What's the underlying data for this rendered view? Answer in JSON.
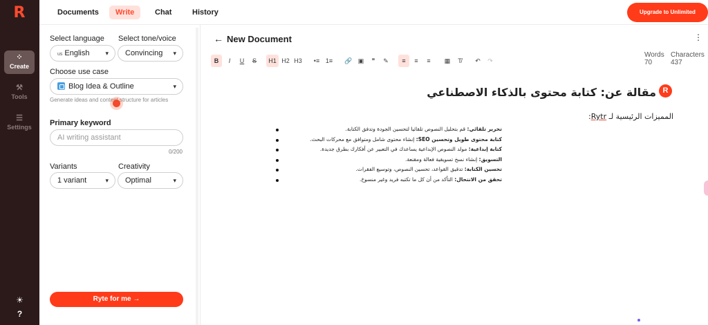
{
  "app": {
    "logo": "R"
  },
  "rail": {
    "items": [
      {
        "label": "Create",
        "icon": "sparkle-icon",
        "glyph": "⁘",
        "active": true
      },
      {
        "label": "Tools",
        "icon": "wrench-icon",
        "glyph": "⚒",
        "active": false
      },
      {
        "label": "Settings",
        "icon": "sliders-icon",
        "glyph": "☰",
        "active": false
      }
    ],
    "theme_icon": "☀",
    "help_icon": "?"
  },
  "nav": {
    "tabs": [
      {
        "label": "Documents",
        "active": false
      },
      {
        "label": "Write",
        "active": true
      },
      {
        "label": "Chat",
        "active": false
      },
      {
        "label": "History",
        "active": false
      }
    ],
    "upgrade_label": "Upgrade to Unlimited"
  },
  "panel": {
    "language_label": "Select language",
    "language_flag": "us",
    "language_value": "English",
    "tone_label": "Select tone/voice",
    "tone_value": "Convincing",
    "usecase_label": "Choose use case",
    "usecase_value": "Blog Idea & Outline",
    "usecase_hint": "Generate ideas and content structure for articles",
    "keyword_label": "Primary keyword",
    "keyword_placeholder": "AI writing assistant",
    "keyword_counter": "0/200",
    "variants_label": "Variants",
    "variants_value": "1 variant",
    "creativity_label": "Creativity",
    "creativity_value": "Optimal",
    "ryte_label": "Ryte for me →"
  },
  "editor": {
    "title": "New Document",
    "toolbar": [
      "B",
      "I",
      "U",
      "S",
      "H1",
      "H2",
      "H3",
      "•≡",
      "1≡",
      "🔗",
      "▣",
      "❞",
      "✎",
      "≡",
      "≡",
      "≡",
      "▦",
      "T̸",
      "↶",
      "↷"
    ],
    "words_label": "Words",
    "words_value": "70",
    "chars_label": "Characters",
    "chars_value": "437",
    "heading": "مقالة عن: كتابة محتوى بالذكاء الاصطناعي",
    "subheading_prefix": "المميزات الرئيسية لـ ",
    "subheading_brand": "Rytr",
    "subheading_suffix": ":",
    "bullets": [
      {
        "bold": "تحرير تلقائي:",
        "text": " قم بتحليل النصوص تلقائيا لتحسين الجودة وتدفق الكتابة."
      },
      {
        "bold": "كتابة محتوى طويل وتحسين SEO:",
        "text": " إنشاء محتوى شامل ومتوافق مع محركات البحث."
      },
      {
        "bold": "كتابة إبداعية:",
        "text": " مولد النصوص الإبداعية يساعدك في التعبير عن أفكارك بطرق جديدة."
      },
      {
        "bold": "التسويق:",
        "text": " إنشاء نسخ تسويقية فعالة ومقنعة."
      },
      {
        "bold": "تحسين الكتابة:",
        "text": " تدقيق القواعد، تحسين النصوص، وتوسيع الفقرات."
      },
      {
        "bold": "تحقق من الانتحال:",
        "text": " التأكد من أن كل ما تكتبه فريد وغير منسوخ."
      }
    ]
  }
}
